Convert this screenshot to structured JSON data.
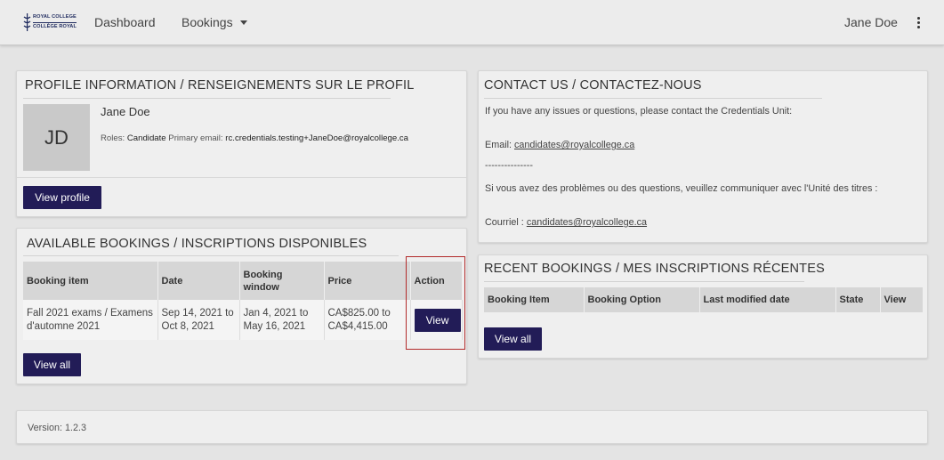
{
  "logo": {
    "line1": "ROYAL COLLEGE",
    "line2": "COLLÈGE ROYAL"
  },
  "nav": {
    "dashboard": "Dashboard",
    "bookings": "Bookings"
  },
  "user": {
    "name": "Jane Doe"
  },
  "profile": {
    "title": "PROFILE INFORMATION / RENSEIGNEMENTS SUR LE PROFIL",
    "initials": "JD",
    "name": "Jane Doe",
    "roles_label": "Roles:",
    "roles_value": "Candidate",
    "email_label": "Primary email:",
    "email_value": "rc.credentials.testing+JaneDoe@royalcollege.ca",
    "view_button": "View profile"
  },
  "available": {
    "title": "AVAILABLE BOOKINGS / INSCRIPTIONS DISPONIBLES",
    "headers": [
      "Booking item",
      "Date",
      "Booking window",
      "Price",
      "Action"
    ],
    "row": {
      "item": "Fall 2021 exams / Examens d'automne 2021",
      "date": "Sep 14, 2021 to Oct 8, 2021",
      "window": "Jan 4, 2021 to May 16, 2021",
      "price": "CA$825.00 to CA$4,415.00",
      "action": "View"
    },
    "view_all": "View all"
  },
  "contact": {
    "title": "CONTACT US / CONTACTEZ-NOUS",
    "line1": "If you have any issues or questions, please contact the Credentials Unit:",
    "email_label": "Email:",
    "email": "candidates@royalcollege.ca",
    "separator": "---------------",
    "line_fr": "Si vous avez des problèmes ou des questions, veuillez communiquer avec l'Unité des titres :",
    "courriel_label": "Courriel :",
    "courriel": "candidates@royalcollege.ca"
  },
  "recent": {
    "title": "RECENT BOOKINGS / MES INSCRIPTIONS RÉCENTES",
    "headers": [
      "Booking Item",
      "Booking Option",
      "Last modified date",
      "State",
      "View"
    ],
    "view_all": "View all"
  },
  "footer": {
    "version": "Version: 1.2.3"
  },
  "colors": {
    "primary_button": "#221c57",
    "highlight_border": "#b22b2b"
  }
}
